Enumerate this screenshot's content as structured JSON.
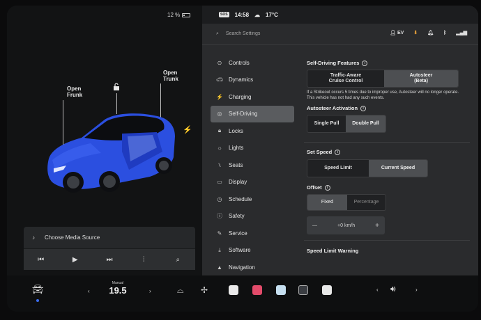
{
  "left": {
    "battery_pct": "12 %",
    "open_frunk": [
      "Open",
      "Frunk"
    ],
    "open_trunk": [
      "Open",
      "Trunk"
    ],
    "car_color": "#2b4fe0"
  },
  "media": {
    "source_label": "Choose Media Source"
  },
  "status": {
    "time": "14:58",
    "temperature": "17°C",
    "sos": "SOS"
  },
  "search": {
    "placeholder": "Search Settings",
    "profile": "EV"
  },
  "menu": {
    "items": [
      {
        "label": "Controls",
        "icon": "toggle-icon"
      },
      {
        "label": "Dynamics",
        "icon": "car-icon"
      },
      {
        "label": "Charging",
        "icon": "bolt-icon"
      },
      {
        "label": "Self-Driving",
        "icon": "steering-wheel-icon"
      },
      {
        "label": "Locks",
        "icon": "lock-icon"
      },
      {
        "label": "Lights",
        "icon": "sun-icon"
      },
      {
        "label": "Seats",
        "icon": "seat-icon"
      },
      {
        "label": "Display",
        "icon": "display-icon"
      },
      {
        "label": "Schedule",
        "icon": "clock-icon"
      },
      {
        "label": "Safety",
        "icon": "shield-icon"
      },
      {
        "label": "Service",
        "icon": "wrench-icon"
      },
      {
        "label": "Software",
        "icon": "download-icon"
      },
      {
        "label": "Navigation",
        "icon": "navigation-icon"
      }
    ],
    "active_index": 3
  },
  "selfdriving": {
    "features_title": "Self-Driving Features",
    "feature_options": [
      [
        "Traffic-Aware",
        "Cruise Control"
      ],
      [
        "Autosteer",
        "(Beta)"
      ]
    ],
    "feature_selected": 1,
    "note": "If a Strikeout occurs 5 times due to improper use, Autosteer will no longer operate. This vehicle has not had any such events.",
    "activation_title": "Autosteer Activation",
    "activation_options": [
      "Single Pull",
      "Double Pull"
    ],
    "activation_selected": 1,
    "speed_title": "Set Speed",
    "speed_options": [
      "Speed Limit",
      "Current Speed"
    ],
    "speed_selected": 1,
    "offset_title": "Offset",
    "offset_options": [
      "Fixed",
      "Percentage"
    ],
    "offset_selected": 0,
    "offset_value": "+0 km/h",
    "offset_minus": "—",
    "offset_plus": "+",
    "speed_warning_title": "Speed Limit Warning"
  },
  "dock": {
    "temp_mode": "Manual",
    "temperature": "19.5"
  }
}
